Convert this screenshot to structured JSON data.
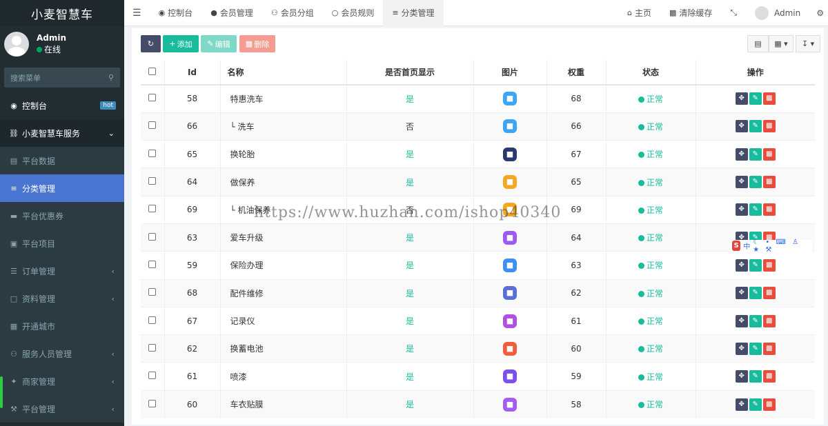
{
  "brand": "小麦智慧车",
  "user": {
    "name": "Admin",
    "status": "在线"
  },
  "search": {
    "placeholder": "搜索菜单"
  },
  "menu": [
    {
      "label": "控制台",
      "icon": "dashboard-icon",
      "badge": "hot"
    },
    {
      "label": "小麦智慧车服务",
      "icon": "car-icon"
    },
    {
      "label": "平台数据",
      "icon": "bar-chart-icon"
    },
    {
      "label": "分类管理",
      "icon": "sliders-icon"
    },
    {
      "label": "平台优惠券",
      "icon": "credit-card-icon"
    },
    {
      "label": "平台项目",
      "icon": "briefcase-icon"
    },
    {
      "label": "订单管理",
      "icon": "list-icon"
    },
    {
      "label": "资料管理",
      "icon": "folder-icon"
    },
    {
      "label": "开通城市",
      "icon": "map-icon"
    },
    {
      "label": "服务人员管理",
      "icon": "users-icon"
    },
    {
      "label": "商家管理",
      "icon": "paw-icon"
    },
    {
      "label": "平台管理",
      "icon": "wrench-icon"
    }
  ],
  "tabs": [
    {
      "label": "控制台",
      "icon": "dashboard-icon"
    },
    {
      "label": "会员管理",
      "icon": "user-icon"
    },
    {
      "label": "会员分组",
      "icon": "users-icon"
    },
    {
      "label": "会员规则",
      "icon": "circle-icon"
    },
    {
      "label": "分类管理",
      "icon": "sliders-icon"
    }
  ],
  "topright": {
    "home": "主页",
    "clear_cache": "清除缓存",
    "admin": "Admin"
  },
  "toolbar": {
    "add": "添加",
    "edit": "编辑",
    "delete": "删除"
  },
  "table": {
    "headers": [
      "Id",
      "名称",
      "是否首页显示",
      "图片",
      "权重",
      "状态",
      "操作"
    ],
    "rows": [
      {
        "id": "58",
        "name": "特惠洗车",
        "show": "是",
        "weight": "68",
        "status": "正常",
        "pic_color": "#3ba6f5"
      },
      {
        "id": "66",
        "name": "└ 洗车",
        "show": "否",
        "weight": "66",
        "status": "正常",
        "pic_color": "#3ba6f5"
      },
      {
        "id": "65",
        "name": "换轮胎",
        "show": "是",
        "weight": "67",
        "status": "正常",
        "pic_color": "#2a3a6e"
      },
      {
        "id": "64",
        "name": "做保养",
        "show": "是",
        "weight": "65",
        "status": "正常",
        "pic_color": "#f5a623"
      },
      {
        "id": "69",
        "name": "└ 机油保养",
        "show": "否",
        "weight": "69",
        "status": "正常",
        "pic_color": "#f5a623"
      },
      {
        "id": "63",
        "name": "爱车升级",
        "show": "是",
        "weight": "64",
        "status": "正常",
        "pic_color": "#9b59f6"
      },
      {
        "id": "59",
        "name": "保险办理",
        "show": "是",
        "weight": "63",
        "status": "正常",
        "pic_color": "#3b8ff5"
      },
      {
        "id": "68",
        "name": "配件维修",
        "show": "是",
        "weight": "62",
        "status": "正常",
        "pic_color": "#5a6ed8"
      },
      {
        "id": "67",
        "name": "记录仪",
        "show": "是",
        "weight": "61",
        "status": "正常",
        "pic_color": "#b14fe0"
      },
      {
        "id": "62",
        "name": "换蓄电池",
        "show": "是",
        "weight": "60",
        "status": "正常",
        "pic_color": "#f25c3b"
      },
      {
        "id": "61",
        "name": "喷漆",
        "show": "是",
        "weight": "59",
        "status": "正常",
        "pic_color": "#7b4ff0"
      },
      {
        "id": "60",
        "name": "车衣贴膜",
        "show": "是",
        "weight": "58",
        "status": "正常",
        "pic_color": "#a55cf0"
      }
    ]
  },
  "watermark": "https://www.huzhan.com/ishop40340",
  "ime": {
    "label": "中"
  }
}
